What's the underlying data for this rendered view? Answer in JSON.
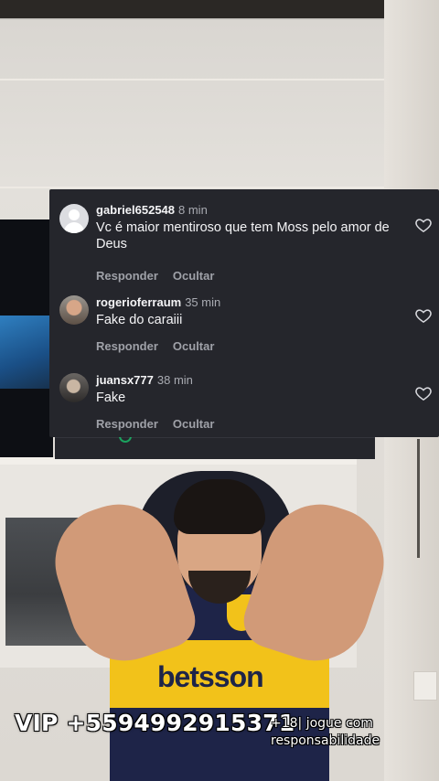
{
  "comments": [
    {
      "username": "gabriel652548",
      "time": "8 min",
      "text": "Vc é maior mentiroso que tem Moss pelo amor de Deus",
      "avatar": "default-avatar-icon",
      "reply_label": "Responder",
      "hide_label": "Ocultar"
    },
    {
      "username": "rogerioferraum",
      "time": "35 min",
      "text": "Fake do caraiii",
      "avatar": "profile-photo",
      "reply_label": "Responder",
      "hide_label": "Ocultar"
    },
    {
      "username": "juansx777",
      "time": "38 min",
      "text": "Fake",
      "avatar": "profile-photo",
      "reply_label": "Responder",
      "hide_label": "Ocultar"
    }
  ],
  "overlay": {
    "vip_text": "VIP +5594992915371",
    "disclaimer_line1": "+18| jogue com",
    "disclaimer_line2": "responsabilidade"
  },
  "video": {
    "shirt_sponsor": "betsson"
  },
  "colors": {
    "panel_bg": "#25262c",
    "action_text": "#9fa1a8",
    "shirt_navy": "#1e2448",
    "shirt_yellow": "#f2c21a"
  }
}
